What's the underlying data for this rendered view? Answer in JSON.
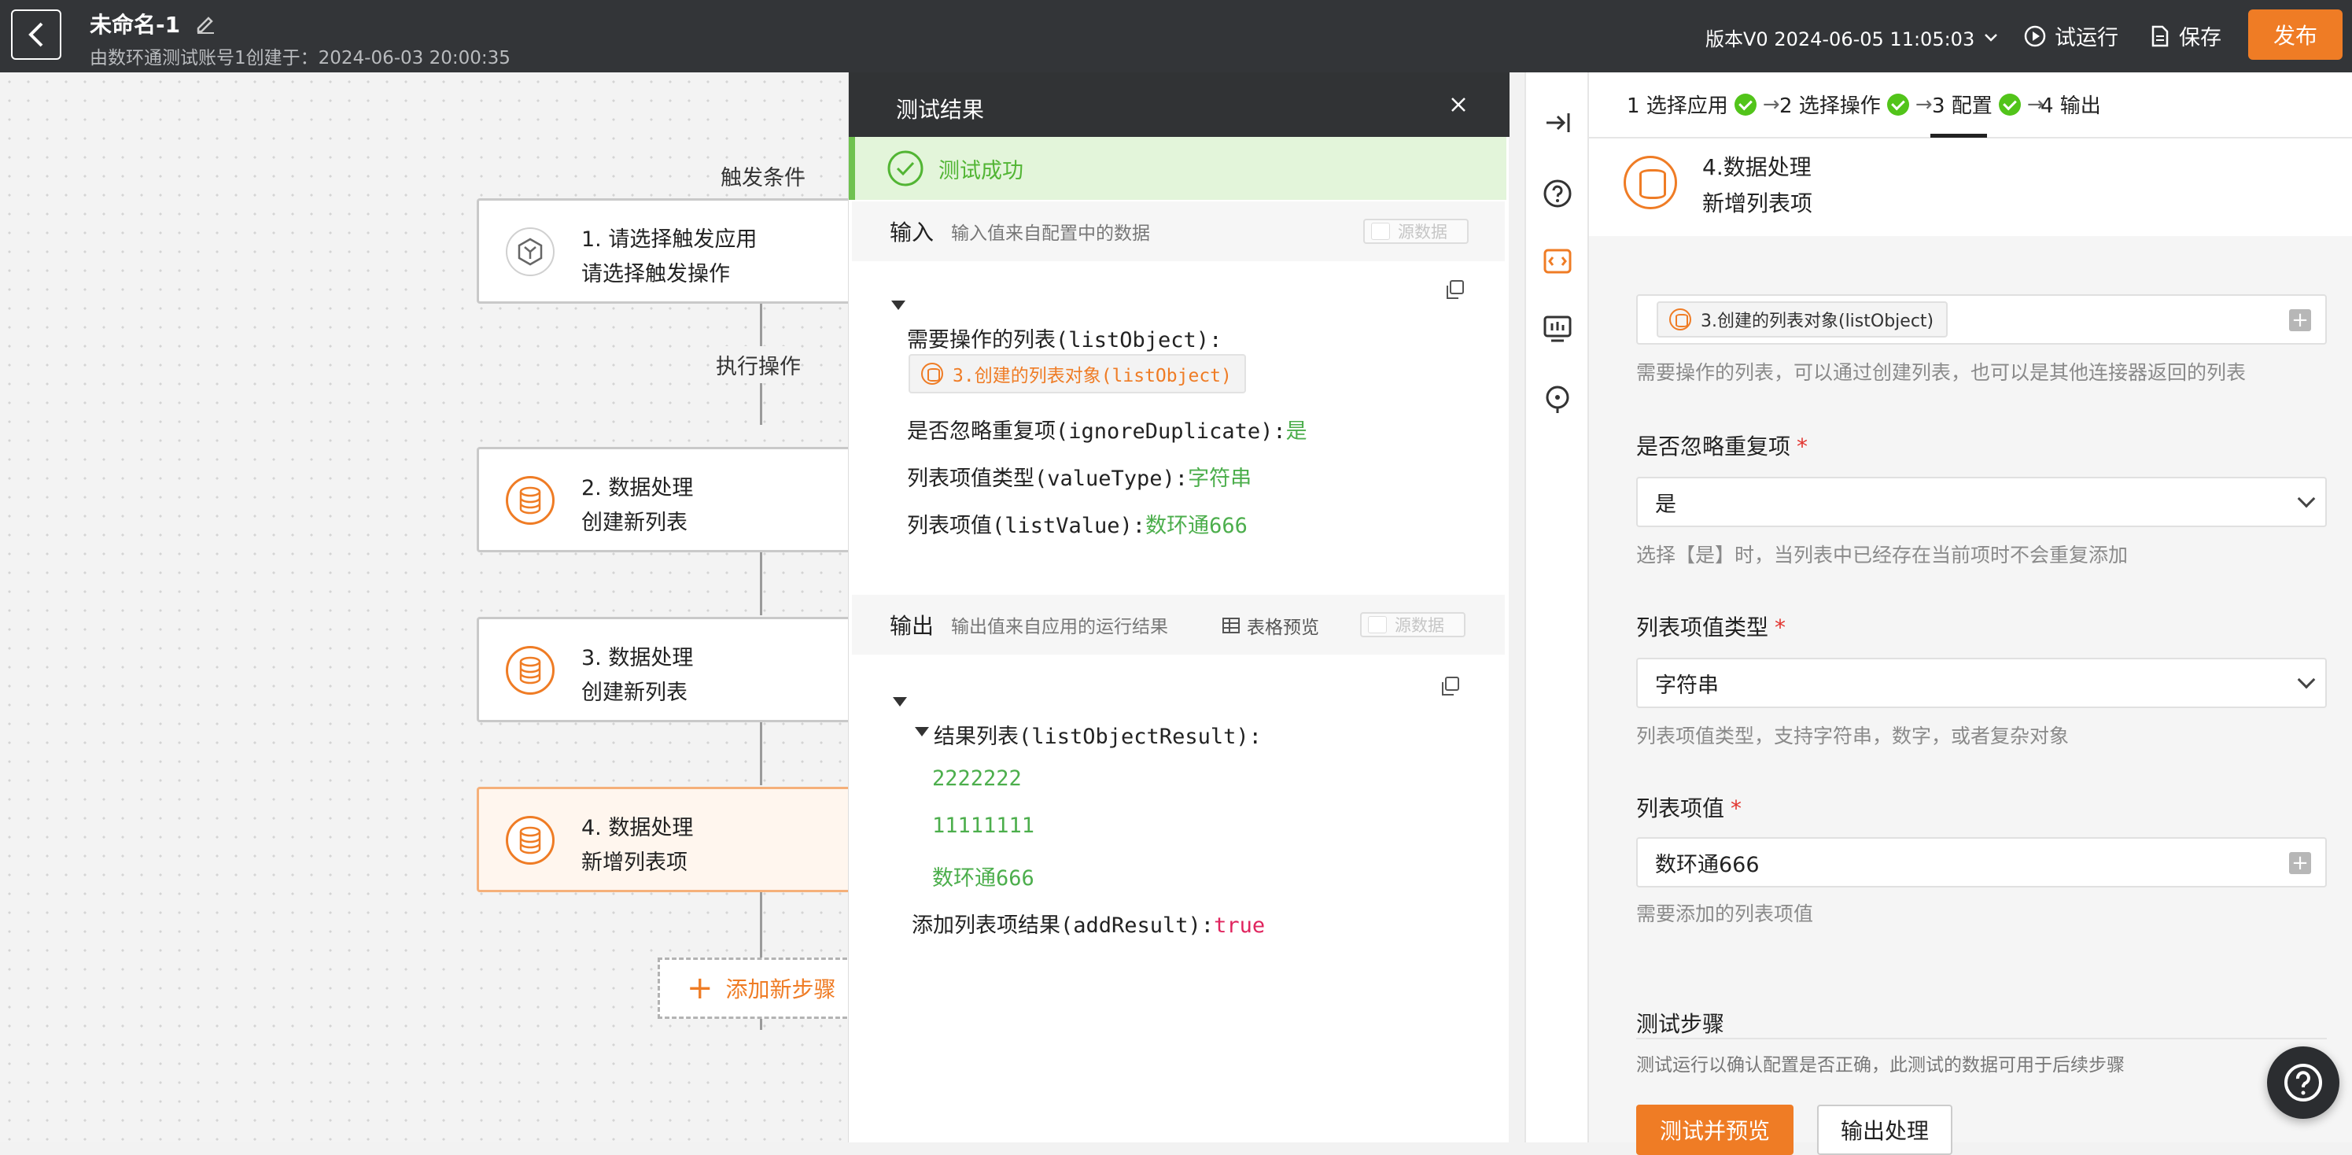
{
  "topbar": {
    "title": "未命名-1",
    "subtitle": "由数环通测试账号1创建于：2024-06-03 20:00:35",
    "version": "版本V0 2024-06-05 11:05:03",
    "run_label": "试运行",
    "save_label": "保存",
    "publish_label": "发布"
  },
  "flow": {
    "trigger_label": "触发条件",
    "action_label": "执行操作",
    "nodes": [
      {
        "line1": "1. 请选择触发应用",
        "line2": "请选择触发操作"
      },
      {
        "line1": "2. 数据处理",
        "line2": "创建新列表"
      },
      {
        "line1": "3. 数据处理",
        "line2": "创建新列表"
      },
      {
        "line1": "4. 数据处理",
        "line2": "新增列表项"
      }
    ],
    "add_step_label": "添加新步骤"
  },
  "test": {
    "title": "测试结果",
    "success": "测试成功",
    "input": {
      "title": "输入",
      "hint": "输入值来自配置中的数据",
      "toggle": "源数据",
      "list_key": "需要操作的列表(listObject):",
      "list_chip": "3.创建的列表对象(listObject)",
      "ignore_key": "是否忽略重复项(ignoreDuplicate):",
      "ignore_val": "是",
      "type_key": "列表项值类型(valueType):",
      "type_val": "字符串",
      "value_key": "列表项值(listValue):",
      "value_val": "数环通666"
    },
    "output": {
      "title": "输出",
      "hint": "输出值来自应用的运行结果",
      "table_preview": "表格预览",
      "toggle": "源数据",
      "result_key": "结果列表(listObjectResult):",
      "result_items": [
        "2222222",
        "11111111",
        "数环通666"
      ],
      "add_key": "添加列表项结果(addResult):",
      "add_val": "true"
    }
  },
  "config": {
    "steps": [
      "1 选择应用",
      "2 选择操作",
      "3 配置",
      "4 输出"
    ],
    "header_line1": "4.数据处理",
    "header_line2": "新增列表项",
    "list_chip": "3.创建的列表对象(listObject)",
    "list_hint": "需要操作的列表，可以通过创建列表，也可以是其他连接器返回的列表",
    "ignore_label": "是否忽略重复项",
    "ignore_value": "是",
    "ignore_hint": "选择【是】时，当列表中已经存在当前项时不会重复添加",
    "type_label": "列表项值类型",
    "type_value": "字符串",
    "type_hint": "列表项值类型，支持字符串，数字，或者复杂对象",
    "value_label": "列表项值",
    "value_value": "数环通666",
    "value_hint": "需要添加的列表项值",
    "test_title": "测试步骤",
    "test_hint": "测试运行以确认配置是否正确，此测试的数据可用于后续步骤",
    "test_btn": "测试并预览",
    "output_btn": "输出处理",
    "required_mark": "*"
  },
  "colors": {
    "accent": "#ef7c25",
    "success": "#52c41a",
    "topbar": "#333538"
  }
}
